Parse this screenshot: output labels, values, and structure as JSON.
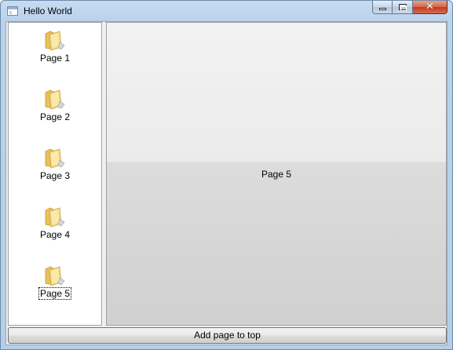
{
  "window": {
    "title": "Hello World"
  },
  "caption_buttons": {
    "close_glyph": "✕"
  },
  "sidebar": {
    "items": [
      {
        "label": "Page 1",
        "icon": "folder-icon",
        "selected": false
      },
      {
        "label": "Page 2",
        "icon": "folder-icon",
        "selected": false
      },
      {
        "label": "Page 3",
        "icon": "folder-icon",
        "selected": false
      },
      {
        "label": "Page 4",
        "icon": "folder-icon",
        "selected": false
      },
      {
        "label": "Page 5",
        "icon": "folder-icon",
        "selected": true
      }
    ]
  },
  "content": {
    "current_page": "Page 5"
  },
  "actions": {
    "add_page_label": "Add page to top"
  },
  "colors": {
    "title_bar": "#b9d2ec",
    "client_background": "#f0f0f0",
    "folder_yellow": "#f3d67a"
  }
}
